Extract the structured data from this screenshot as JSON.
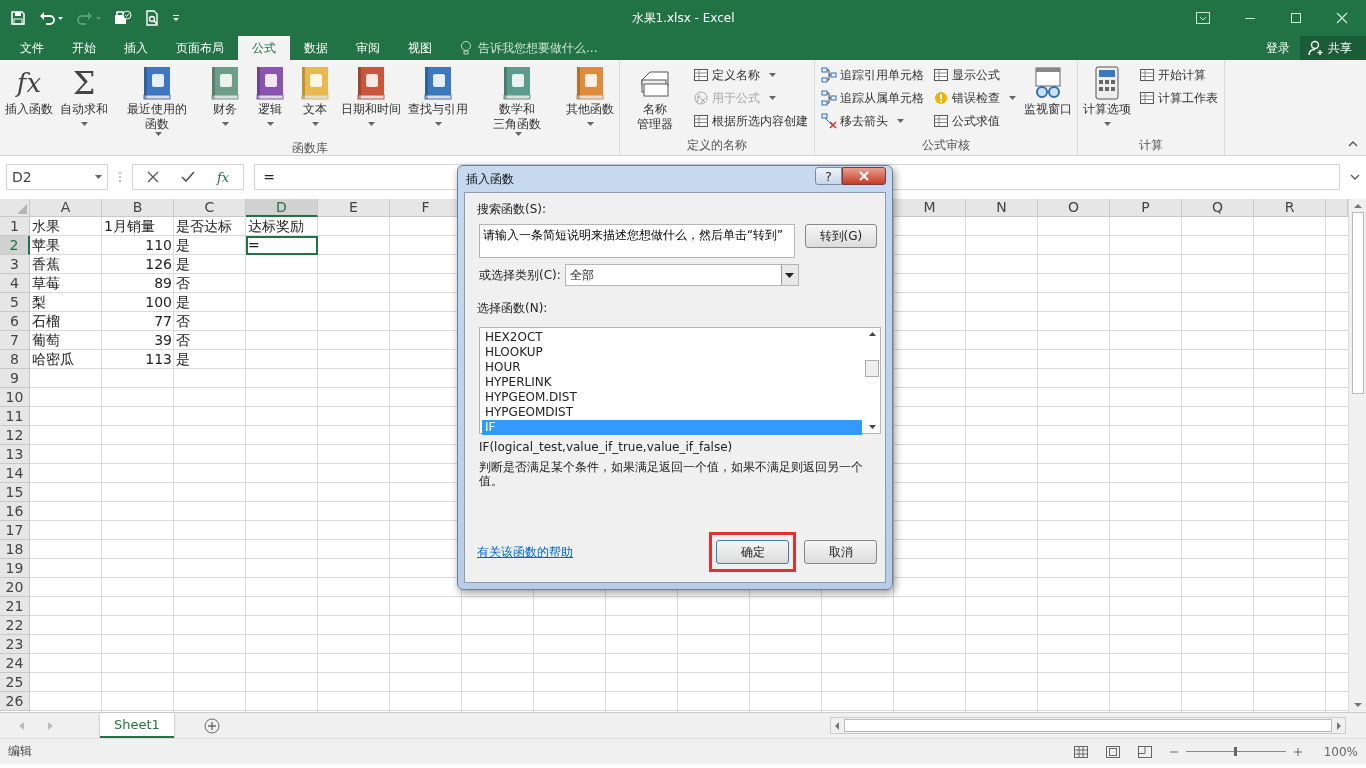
{
  "window": {
    "title": "水果1.xlsx - Excel",
    "sign_in": "登录",
    "share": "共享"
  },
  "tabs": [
    {
      "label": "文件",
      "selected": false
    },
    {
      "label": "开始",
      "selected": false
    },
    {
      "label": "插入",
      "selected": false
    },
    {
      "label": "页面布局",
      "selected": false
    },
    {
      "label": "公式",
      "selected": true
    },
    {
      "label": "数据",
      "selected": false
    },
    {
      "label": "审阅",
      "selected": false
    },
    {
      "label": "视图",
      "selected": false
    }
  ],
  "tell_me": {
    "placeholder": "告诉我您想要做什么..."
  },
  "ribbon": {
    "groups": [
      {
        "title": "函数库",
        "items": [
          {
            "kind": "large",
            "label": "插入函数",
            "glyph": "fx",
            "dropdown": false
          },
          {
            "kind": "large",
            "label": "自动求和",
            "glyph": "Σ",
            "dropdown": true
          },
          {
            "kind": "large",
            "label": "最近使用的函数",
            "dropdown": true
          },
          {
            "kind": "large",
            "label": "财务",
            "dropdown": true
          },
          {
            "kind": "large",
            "label": "逻辑",
            "dropdown": true
          },
          {
            "kind": "large",
            "label": "文本",
            "dropdown": true
          },
          {
            "kind": "large",
            "label": "日期和时间",
            "dropdown": true
          },
          {
            "kind": "large",
            "label": "查找与引用",
            "dropdown": true
          },
          {
            "kind": "large",
            "label": "数学和三角函数",
            "dropdown": true
          },
          {
            "kind": "large",
            "label": "其他函数",
            "dropdown": true
          }
        ]
      },
      {
        "title": "定义的名称",
        "items": [
          {
            "kind": "large",
            "label": "名称管理器",
            "dropdown": false
          },
          {
            "kind": "small",
            "label": "定义名称",
            "dropdown": true,
            "disabled": false
          },
          {
            "kind": "small",
            "label": "用于公式",
            "dropdown": true,
            "disabled": true
          },
          {
            "kind": "small",
            "label": "根据所选内容创建",
            "dropdown": false,
            "disabled": false
          }
        ]
      },
      {
        "title": "公式审核",
        "items": [
          {
            "kind": "small",
            "label": "追踪引用单元格",
            "dropdown": false,
            "disabled": false
          },
          {
            "kind": "small",
            "label": "追踪从属单元格",
            "dropdown": false,
            "disabled": false
          },
          {
            "kind": "small",
            "label": "移去箭头",
            "dropdown": true,
            "disabled": false
          },
          {
            "kind": "small",
            "label": "显示公式",
            "dropdown": false,
            "disabled": false
          },
          {
            "kind": "small",
            "label": "错误检查",
            "dropdown": true,
            "disabled": false
          },
          {
            "kind": "small",
            "label": "公式求值",
            "dropdown": false,
            "disabled": false
          },
          {
            "kind": "large",
            "label": "监视窗口",
            "dropdown": false
          }
        ]
      },
      {
        "title": "计算",
        "items": [
          {
            "kind": "large",
            "label": "计算选项",
            "dropdown": true
          },
          {
            "kind": "small",
            "label": "开始计算",
            "dropdown": false,
            "disabled": false
          },
          {
            "kind": "small",
            "label": "计算工作表",
            "dropdown": false,
            "disabled": false
          }
        ]
      }
    ]
  },
  "formula_bar": {
    "name_box": "D2",
    "fx": "fx",
    "formula": "="
  },
  "sheet": {
    "columns_left": [
      "A",
      "B",
      "C",
      "D",
      "E",
      "F"
    ],
    "columns_right": [
      "M",
      "N",
      "O",
      "P",
      "Q",
      "R"
    ],
    "rows": [
      {
        "number": "1",
        "cells": [
          {
            "text": "水果",
            "kind": "text",
            "selected": false
          },
          {
            "text": "1月销量",
            "kind": "text",
            "selected": false
          },
          {
            "text": "是否达标",
            "kind": "text",
            "selected": false
          },
          {
            "text": "达标奖励",
            "kind": "text",
            "selected": false
          }
        ]
      },
      {
        "number": "2",
        "cells": [
          {
            "text": "苹果",
            "kind": "text",
            "selected": false
          },
          {
            "text": "110",
            "kind": "number",
            "selected": false
          },
          {
            "text": "是",
            "kind": "text",
            "selected": false
          },
          {
            "text": "=",
            "kind": "text",
            "selected": true
          }
        ]
      },
      {
        "number": "3",
        "cells": [
          {
            "text": "香蕉",
            "kind": "text",
            "selected": false
          },
          {
            "text": "126",
            "kind": "number",
            "selected": false
          },
          {
            "text": "是",
            "kind": "text",
            "selected": false
          }
        ]
      },
      {
        "number": "4",
        "cells": [
          {
            "text": "草莓",
            "kind": "text",
            "selected": false
          },
          {
            "text": "89",
            "kind": "number",
            "selected": false
          },
          {
            "text": "否",
            "kind": "text",
            "selected": false
          }
        ]
      },
      {
        "number": "5",
        "cells": [
          {
            "text": "梨",
            "kind": "text",
            "selected": false
          },
          {
            "text": "100",
            "kind": "number",
            "selected": false
          },
          {
            "text": "是",
            "kind": "text",
            "selected": false
          }
        ]
      },
      {
        "number": "6",
        "cells": [
          {
            "text": "石榴",
            "kind": "text",
            "selected": false
          },
          {
            "text": "77",
            "kind": "number",
            "selected": false
          },
          {
            "text": "否",
            "kind": "text",
            "selected": false
          }
        ]
      },
      {
        "number": "7",
        "cells": [
          {
            "text": "葡萄",
            "kind": "text",
            "selected": false
          },
          {
            "text": "39",
            "kind": "number",
            "selected": false
          },
          {
            "text": "否",
            "kind": "text",
            "selected": false
          }
        ]
      },
      {
        "number": "8",
        "cells": [
          {
            "text": "哈密瓜",
            "kind": "text",
            "selected": false
          },
          {
            "text": "113",
            "kind": "number",
            "selected": false
          },
          {
            "text": "是",
            "kind": "text",
            "selected": false
          }
        ]
      },
      {
        "number": "9",
        "cells": []
      },
      {
        "number": "10",
        "cells": []
      },
      {
        "number": "11",
        "cells": []
      },
      {
        "number": "12",
        "cells": []
      },
      {
        "number": "13",
        "cells": []
      },
      {
        "number": "14",
        "cells": []
      },
      {
        "number": "15",
        "cells": []
      },
      {
        "number": "16",
        "cells": []
      },
      {
        "number": "17",
        "cells": []
      },
      {
        "number": "18",
        "cells": []
      },
      {
        "number": "19",
        "cells": []
      },
      {
        "number": "20",
        "cells": []
      },
      {
        "number": "21",
        "cells": []
      },
      {
        "number": "22",
        "cells": []
      },
      {
        "number": "23",
        "cells": []
      },
      {
        "number": "24",
        "cells": []
      },
      {
        "number": "25",
        "cells": []
      },
      {
        "number": "26",
        "cells": []
      }
    ]
  },
  "sheet_tabs": [
    {
      "name": "Sheet1",
      "selected": true
    }
  ],
  "status_bar": {
    "mode": "编辑",
    "zoom": "100%",
    "level": 0.5
  },
  "dialog": {
    "title": "插入函数",
    "help_glyph": "?",
    "search_label": "搜索函数(S):",
    "search_value": "请输入一条简短说明来描述您想做什么，然后单击“转到”",
    "go_button": "转到(G)",
    "category_label": "或选择类别(C):",
    "category_value": "全部",
    "function_label": "选择函数(N):",
    "functions": [
      {
        "name": "HEX2OCT",
        "selected": false
      },
      {
        "name": "HLOOKUP",
        "selected": false
      },
      {
        "name": "HOUR",
        "selected": false
      },
      {
        "name": "HYPERLINK",
        "selected": false
      },
      {
        "name": "HYPGEOM.DIST",
        "selected": false
      },
      {
        "name": "HYPGEOMDIST",
        "selected": false
      },
      {
        "name": "IF",
        "selected": true
      }
    ],
    "signature": "IF(logical_test,value_if_true,value_if_false)",
    "description": "判断是否满足某个条件，如果满足返回一个值，如果不满足则返回另一个值。",
    "help_link": "有关该函数的帮助",
    "ok_button": {
      "label": "确定",
      "highlighted": true
    },
    "cancel_button": "取消"
  }
}
